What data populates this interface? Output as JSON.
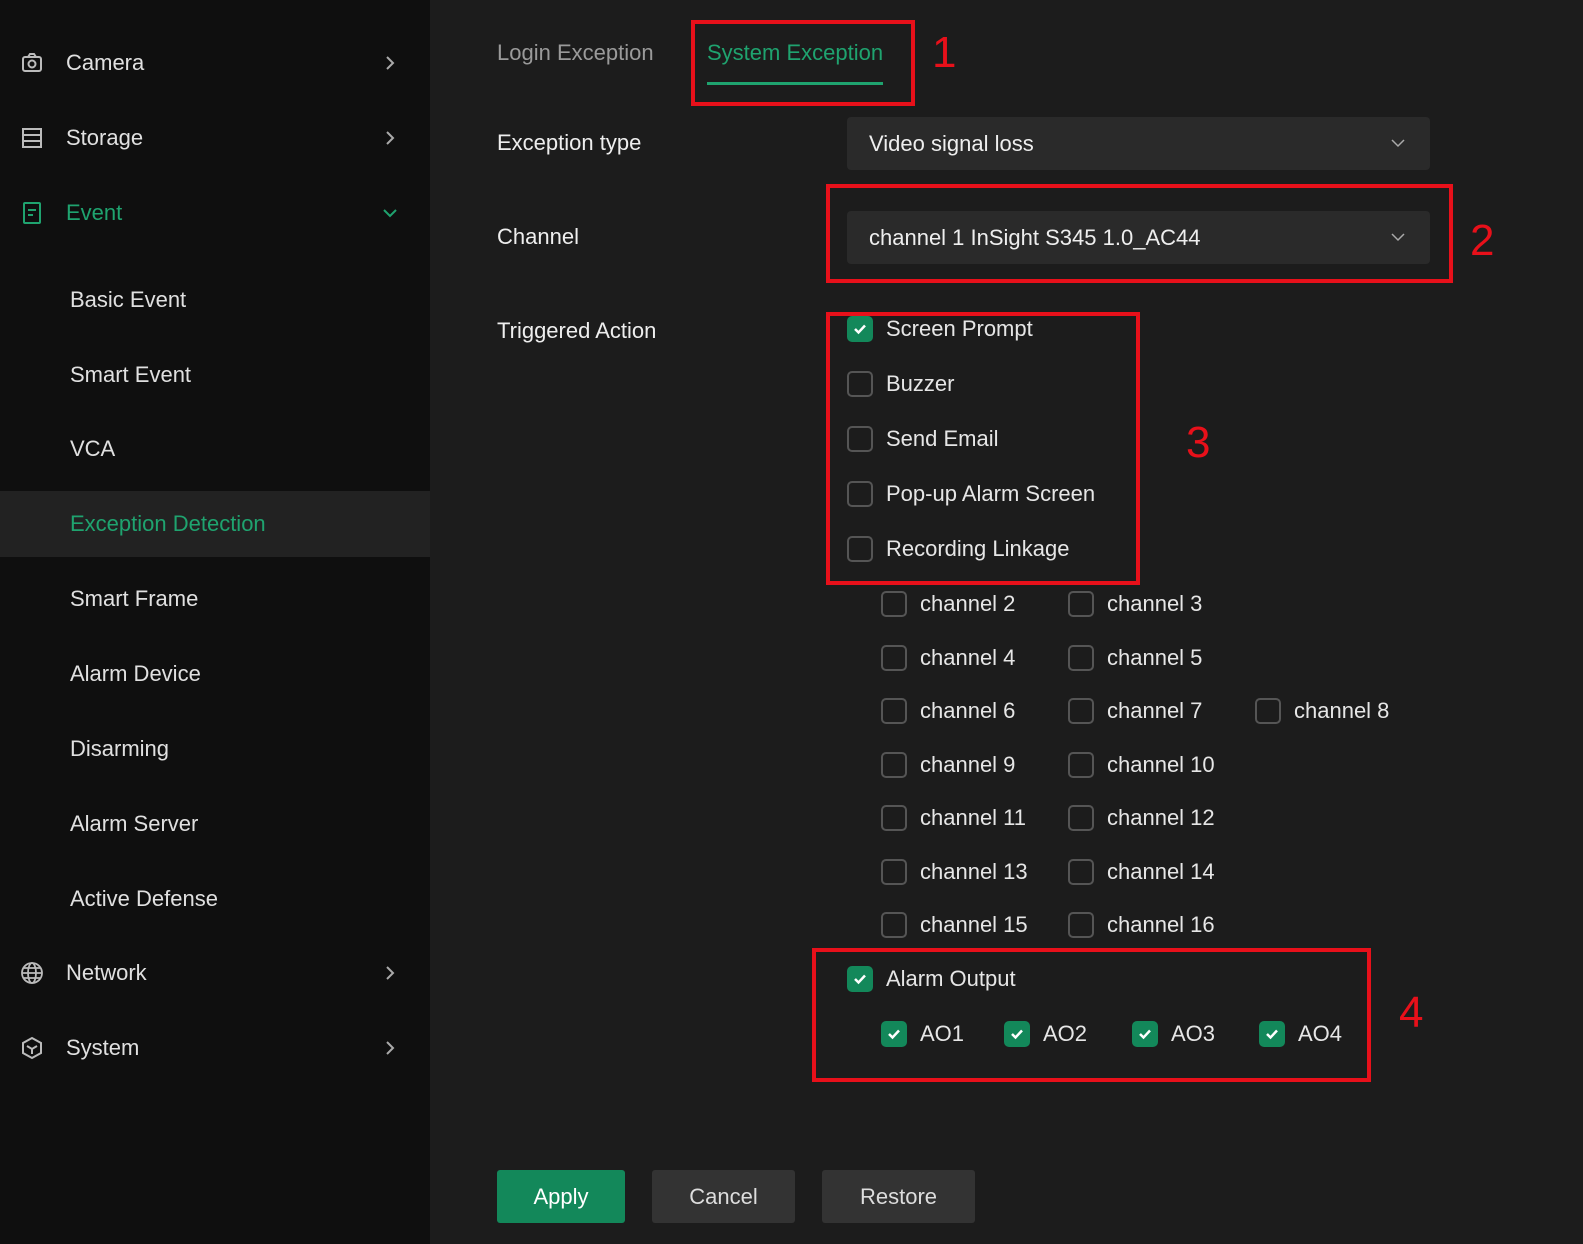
{
  "sidebar": {
    "camera": "Camera",
    "storage": "Storage",
    "event": "Event",
    "sub": [
      "Basic Event",
      "Smart Event",
      "VCA",
      "Exception Detection",
      "Smart Frame",
      "Alarm Device",
      "Disarming",
      "Alarm Server",
      "Active Defense"
    ],
    "network": "Network",
    "system": "System"
  },
  "tabs": {
    "login": "Login Exception",
    "system": "System Exception"
  },
  "form": {
    "exception_type_label": "Exception type",
    "exception_type_value": "Video signal loss",
    "channel_label": "Channel",
    "channel_value": "channel 1 InSight S345 1.0_AC44",
    "triggered_label": "Triggered Action",
    "actions": [
      {
        "label": "Screen Prompt",
        "checked": true
      },
      {
        "label": "Buzzer",
        "checked": false
      },
      {
        "label": "Send Email",
        "checked": false
      },
      {
        "label": "Pop-up Alarm Screen",
        "checked": false
      },
      {
        "label": "Recording Linkage",
        "checked": false
      }
    ],
    "channels": [
      "channel 2",
      "channel 3",
      "channel 4",
      "channel 5",
      "channel 6",
      "channel 7",
      "channel 8",
      "channel 9",
      "channel 10",
      "channel 11",
      "channel 12",
      "channel 13",
      "channel 14",
      "channel 15",
      "channel 16"
    ],
    "alarm_output": {
      "label": "Alarm Output",
      "checked": true
    },
    "outputs": [
      "AO1",
      "AO2",
      "AO3",
      "AO4"
    ]
  },
  "buttons": {
    "apply": "Apply",
    "cancel": "Cancel",
    "restore": "Restore"
  },
  "annotations": [
    "1",
    "2",
    "3",
    "4"
  ],
  "colors": {
    "accent": "#1fa36f",
    "annotation": "#e8101a"
  }
}
